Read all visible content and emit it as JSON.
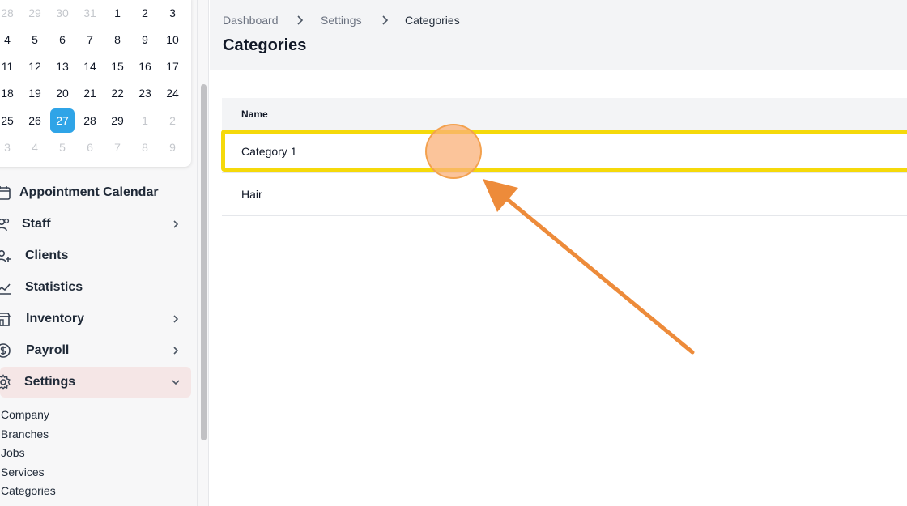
{
  "calendar": {
    "rows": [
      [
        {
          "d": "28",
          "muted": true
        },
        {
          "d": "29",
          "muted": true
        },
        {
          "d": "30",
          "muted": true
        },
        {
          "d": "31",
          "muted": true
        },
        {
          "d": "1",
          "muted": false
        },
        {
          "d": "2",
          "muted": false
        },
        {
          "d": "3",
          "muted": false
        }
      ],
      [
        {
          "d": "4"
        },
        {
          "d": "5"
        },
        {
          "d": "6"
        },
        {
          "d": "7"
        },
        {
          "d": "8"
        },
        {
          "d": "9"
        },
        {
          "d": "10"
        }
      ],
      [
        {
          "d": "11"
        },
        {
          "d": "12"
        },
        {
          "d": "13"
        },
        {
          "d": "14"
        },
        {
          "d": "15"
        },
        {
          "d": "16"
        },
        {
          "d": "17"
        }
      ],
      [
        {
          "d": "18"
        },
        {
          "d": "19"
        },
        {
          "d": "20"
        },
        {
          "d": "21"
        },
        {
          "d": "22"
        },
        {
          "d": "23"
        },
        {
          "d": "24"
        }
      ],
      [
        {
          "d": "25"
        },
        {
          "d": "26"
        },
        {
          "d": "27",
          "selected": true
        },
        {
          "d": "28"
        },
        {
          "d": "29"
        },
        {
          "d": "1",
          "muted": true
        },
        {
          "d": "2",
          "muted": true
        }
      ],
      [
        {
          "d": "3",
          "muted": true
        },
        {
          "d": "4",
          "muted": true
        },
        {
          "d": "5",
          "muted": true
        },
        {
          "d": "6",
          "muted": true
        },
        {
          "d": "7",
          "muted": true
        },
        {
          "d": "8",
          "muted": true
        },
        {
          "d": "9",
          "muted": true
        }
      ]
    ],
    "selected_color": "#2fa4e7"
  },
  "sidebar": {
    "nav": [
      {
        "label": "Appointment Calendar",
        "icon": "calendar-icon",
        "chevron": "none"
      },
      {
        "label": "Staff",
        "icon": "staff-icon",
        "chevron": "right"
      },
      {
        "label": "Clients",
        "icon": "add-user-icon",
        "chevron": "none"
      },
      {
        "label": "Statistics",
        "icon": "chart-line-icon",
        "chevron": "none"
      },
      {
        "label": "Inventory",
        "icon": "store-icon",
        "chevron": "right"
      },
      {
        "label": "Payroll",
        "icon": "dollar-icon",
        "chevron": "right"
      },
      {
        "label": "Settings",
        "icon": "gear-icon",
        "chevron": "down",
        "active": true
      }
    ],
    "settings_sub": [
      "Company",
      "Branches",
      "Jobs",
      "Services",
      "Categories"
    ]
  },
  "breadcrumb": [
    "Dashboard",
    "Settings",
    "Categories"
  ],
  "page": {
    "title": "Categories"
  },
  "table": {
    "columns": [
      "Name"
    ],
    "rows": [
      "Category 1",
      "Hair"
    ]
  },
  "annotation": {
    "highlight_color": "#f5d90a",
    "arrow_color": "#ed8b3a"
  }
}
